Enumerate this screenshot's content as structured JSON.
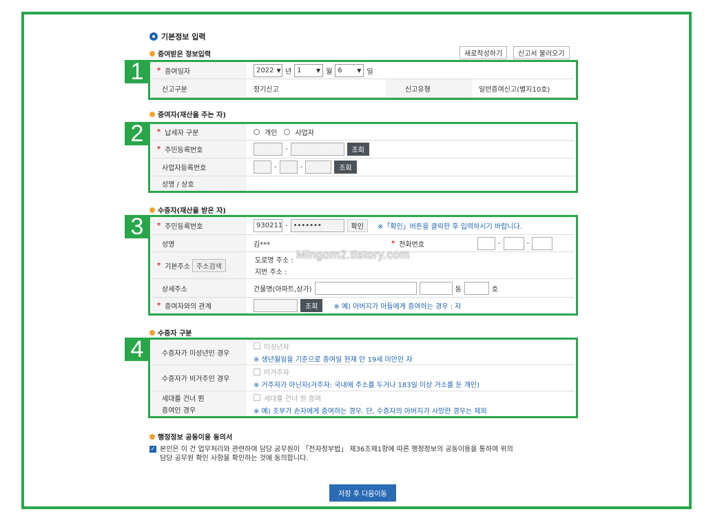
{
  "title": "기본정보 입력",
  "sections": {
    "s1": "증여받은 정보입력",
    "s2": "증여자(재산을 주는 자)",
    "s3": "수증자(재산을 받은 자)",
    "s4": "수증자 구분",
    "s5": "행정정보 공동이용 동의서"
  },
  "buttons": {
    "new": "새로작성하기",
    "load": "신고서 불러오기",
    "lookup": "조회",
    "confirm": "확인",
    "addr_search": "주소검색",
    "save_next": "저장 후 다음이동"
  },
  "markers": [
    "1",
    "2",
    "3",
    "4"
  ],
  "gift_info": {
    "date_label": "증여일자",
    "year": "2022",
    "year_unit": "년",
    "month": "1",
    "month_unit": "월",
    "day": "6",
    "day_unit": "일",
    "report_type_label": "신고구분",
    "report_type": "정기신고",
    "report_kind_label": "신고유형",
    "report_kind": "일반증여신고(별지10호)"
  },
  "donor": {
    "taxpayer_type_label": "납세자 구분",
    "opt_individual": "개인",
    "opt_business": "사업자",
    "resident_no_label": "주민등록번호",
    "business_no_label": "사업자등록번호",
    "name_label": "성명 / 상호",
    "dash": "-"
  },
  "recipient": {
    "resident_no_label": "주민등록번호",
    "resident_front": "930211",
    "resident_back": "•••••••",
    "confirm_note": "※「확인」버튼을 클릭한 후 입력하시기 바랍니다.",
    "name_label": "성명",
    "name": "김***",
    "phone_label": "전화번호",
    "address_label": "기본주소",
    "road_addr": "도로명 주소 :",
    "lot_addr": "지번 주소 :",
    "detail_label": "상세주소",
    "building_label": "건물명(아파트,상가)",
    "dong": "동",
    "ho": "호",
    "relation_label": "증여자와의 관계",
    "relation_note": "※ 예) 아버지가 아들에게 증여하는 경우 : 자"
  },
  "classification": [
    {
      "label": "수증자가 미성년인 경우",
      "check": "미성년자",
      "note": "※ 생년월일을 기준으로 증여일 현재 만 19세 미만인 자"
    },
    {
      "label": "수증자가 비거주인 경우",
      "check": "비거주자",
      "note": "※ 거주자가 아닌자(거주자: 국내에 주소를 두거나 183일 이상 거소를 둔 개인)"
    },
    {
      "label1": "세대를 건너 뛴",
      "label2": "증여인 경우",
      "check": "세대를 건너 뛴 증여",
      "note": "※ 예) 조부가 손자에게 증여하는 경우. 단, 수증자의 아버지가 사망한 경우는 제외"
    }
  ],
  "consent": {
    "line1": "본인은 이 건 업무처리와 관련하여 담당 공무원이 「전자정부법」 제36조제1항에 따른 행정정보의 공동이용을 통하여 위의",
    "line2": "담당 공무원 확인 사항을 확인하는 것에 동의합니다."
  },
  "watermark": "Mingom2.tistory.com",
  "colors": {
    "green": "#2aa64a",
    "blue": "#1f63b0",
    "required": "#d9252b",
    "orange": "#f0a22e"
  }
}
